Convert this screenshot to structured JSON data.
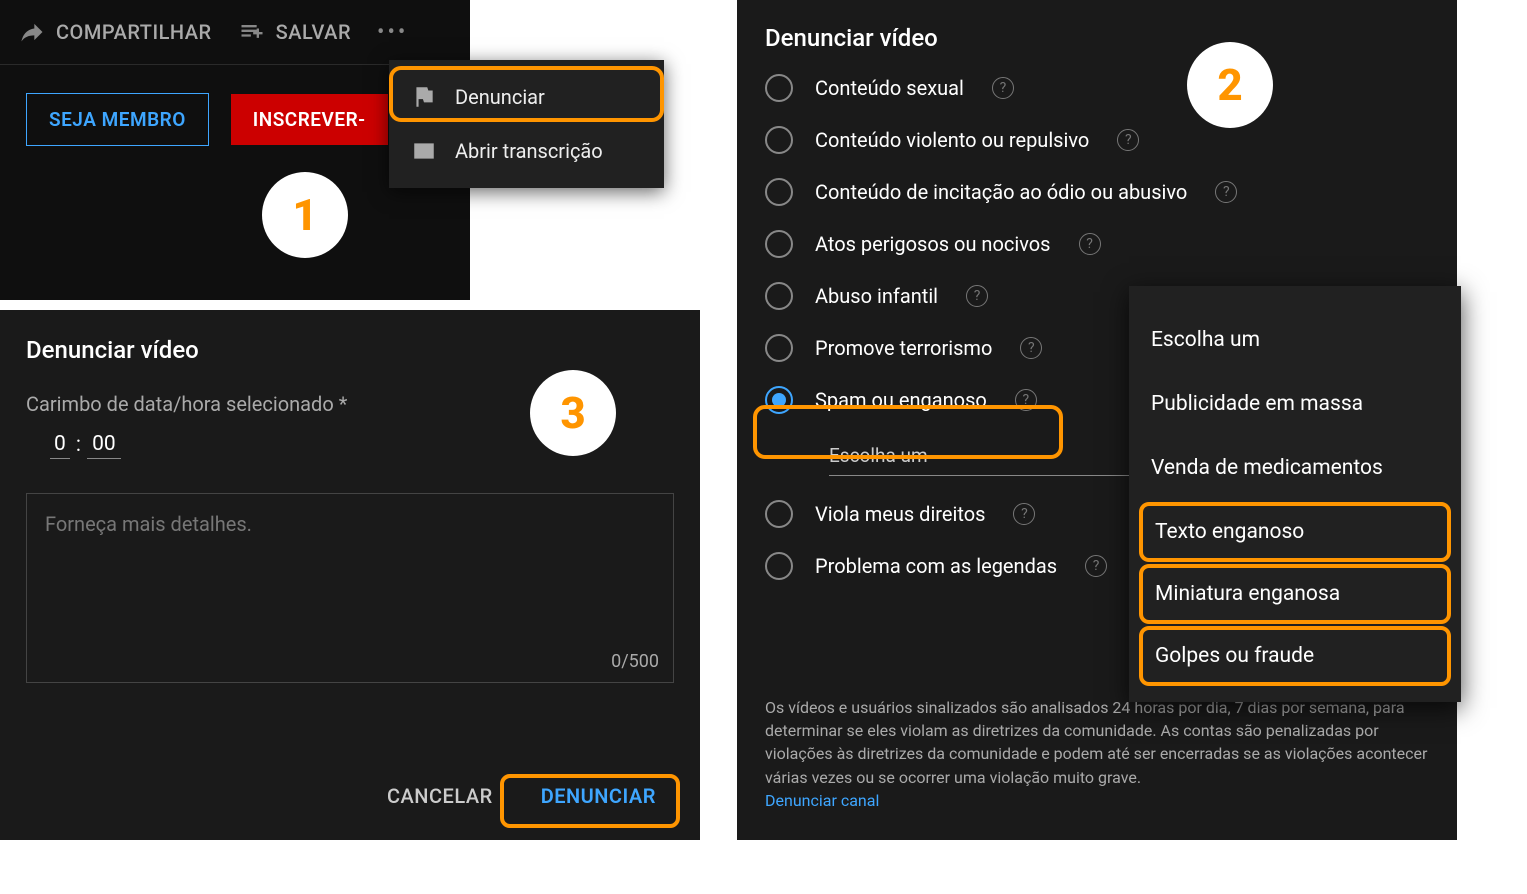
{
  "panel1": {
    "share": "COMPARTILHAR",
    "save": "SALVAR",
    "member": "SEJA MEMBRO",
    "subscribe": "INSCREVER-",
    "menu": {
      "report": "Denunciar",
      "transcript": "Abrir transcrição"
    }
  },
  "panel3": {
    "title": "Denunciar vídeo",
    "stampLabel": "Carimbo de data/hora selecionado *",
    "min": "0",
    "sec": "00",
    "placeholder": "Forneça mais detalhes.",
    "count": "0/500",
    "cancel": "CANCELAR",
    "submit": "DENUNCIAR"
  },
  "panel2": {
    "title": "Denunciar vídeo",
    "reasons": [
      "Conteúdo sexual",
      "Conteúdo violento ou repulsivo",
      "Conteúdo de incitação ao ódio ou abusivo",
      "Atos perigosos ou nocivos",
      "Abuso infantil",
      "Promove terrorismo",
      "Spam ou enganoso",
      "Viola meus direitos",
      "Problema com as legendas"
    ],
    "subSelect": "Escolha um",
    "disclaimer": "Os vídeos e usuários sinalizados são analisados 24 horas por dia, 7 dias por semana, para determinar se eles violam as diretrizes da comunidade. As contas são penalizadas por violações às diretrizes da comunidade e podem até ser encerradas se as violações acontecer várias vezes ou se ocorrer uma violação muito grave.",
    "reportChannel": "Denunciar canal"
  },
  "dropdown": {
    "header": "Escolha um",
    "items": [
      "Publicidade em massa",
      "Venda de medicamentos",
      "Texto enganoso",
      "Miniatura enganosa",
      "Golpes ou fraude"
    ]
  },
  "badges": {
    "one": "1",
    "two": "2",
    "three": "3"
  }
}
